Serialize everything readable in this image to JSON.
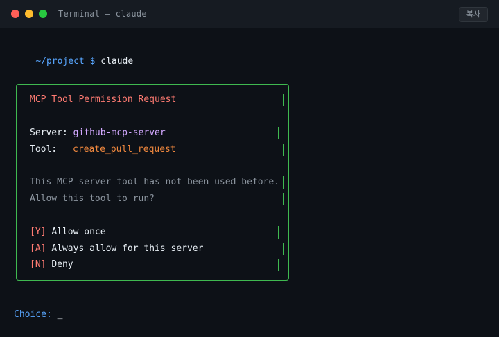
{
  "window": {
    "title": "Terminal — claude",
    "copy_label": "복사"
  },
  "prompt": {
    "path": "~/project",
    "symbol": "$",
    "command": "claude"
  },
  "dialog": {
    "title": "MCP Tool Permission Request",
    "server_label": "Server:",
    "server_value": "github-mcp-server",
    "tool_label": "Tool:",
    "tool_value": "create_pull_request",
    "message_line1": "This MCP server tool has not been used before.",
    "message_line2": "Allow this tool to run?",
    "options": [
      {
        "key": "[Y]",
        "label": "Allow once"
      },
      {
        "key": "[A]",
        "label": "Always allow for this server"
      },
      {
        "key": "[N]",
        "label": "Deny"
      }
    ]
  },
  "input": {
    "label": "Choice:",
    "cursor": "_"
  },
  "colors": {
    "background": "#0d1117",
    "border": "#3fb950",
    "title": "#ff7b72",
    "server": "#d2a8ff",
    "tool": "#f0883e",
    "prompt": "#58a6ff"
  }
}
